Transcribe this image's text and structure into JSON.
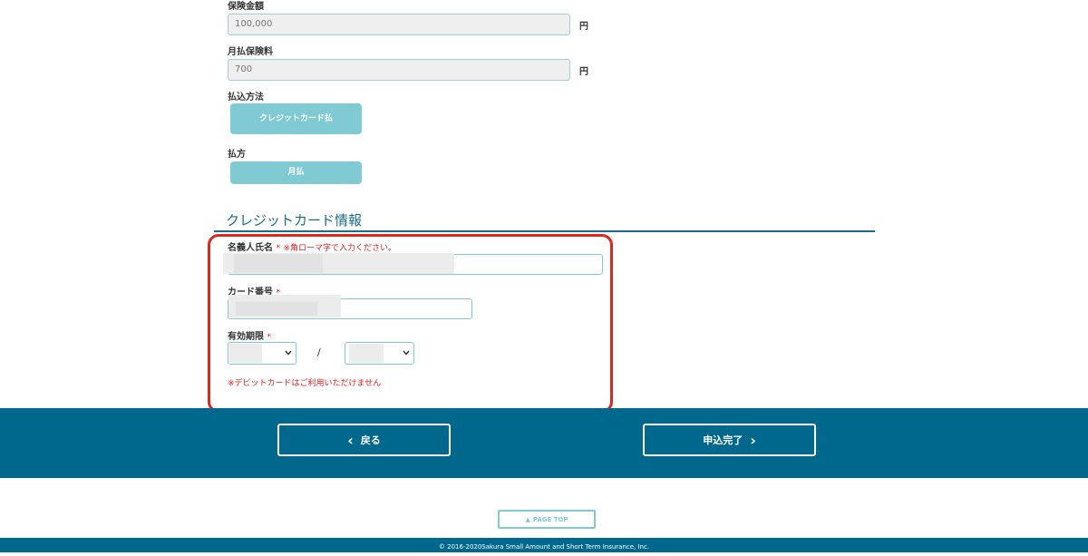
{
  "insurance_amount": {
    "label": "保険金額",
    "value": "100,000",
    "unit": "円"
  },
  "monthly_premium": {
    "label": "月払保険料",
    "value": "700",
    "unit": "円"
  },
  "payment_method": {
    "label": "払込方法",
    "button": "クレジットカード払"
  },
  "payment_frequency": {
    "label": "払方",
    "button": "月払"
  },
  "credit_card_section": {
    "title": "クレジットカード情報",
    "holder_name": {
      "label": "名義人氏名",
      "required_mark": "*",
      "note": "※角ローマ字で入力ください。"
    },
    "card_number": {
      "label": "カード番号",
      "required_mark": "*"
    },
    "expiry": {
      "label": "有効期限",
      "required_mark": "*",
      "separator": "/"
    },
    "debit_note": "※デビットカードはご利用いただけません"
  },
  "navigation": {
    "back_label": "戻る",
    "back_icon": "‹",
    "submit_label": "申込完了",
    "submit_icon": "›"
  },
  "page_top": {
    "label": "PAGE TOP",
    "icon": "▲"
  },
  "footer": {
    "copyright": "© 2016-2020Sakura Small Amount and Short Term Insurance, Inc."
  },
  "colors": {
    "accent": "#80cad3",
    "brand": "#00678d",
    "required": "#e02020",
    "highlight": "#e1261c"
  }
}
